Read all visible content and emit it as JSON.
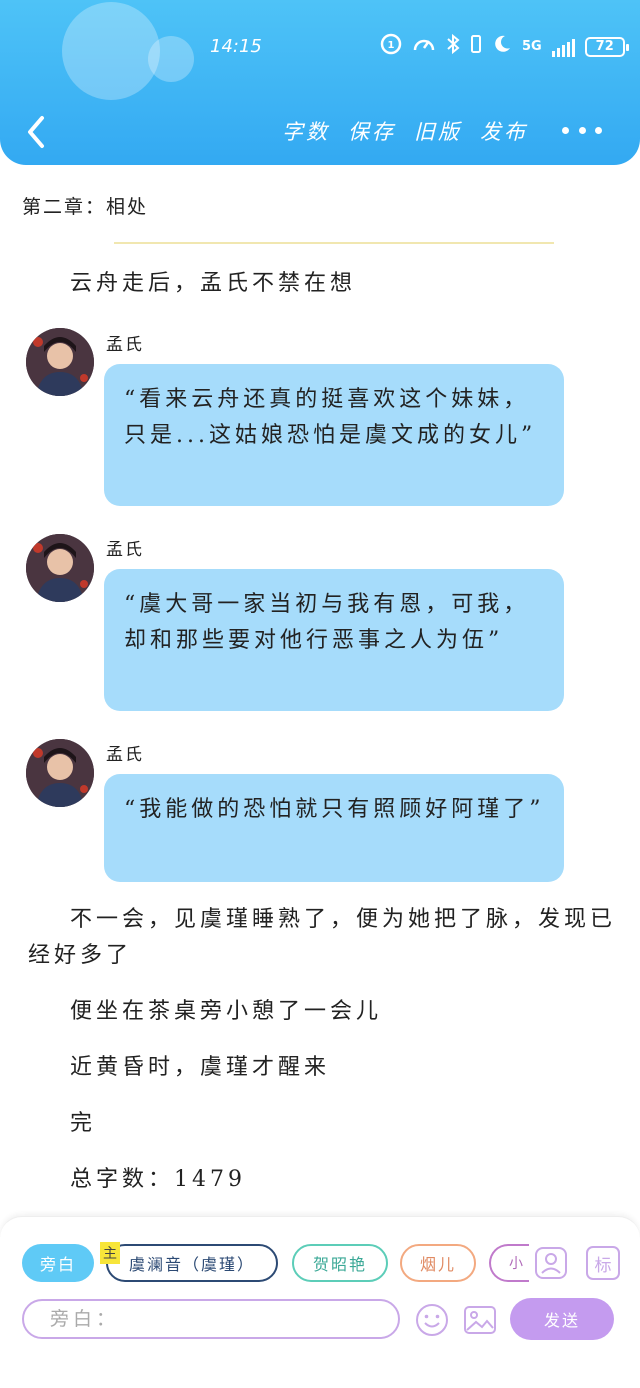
{
  "status_bar": {
    "time": "14:15",
    "network": "5G",
    "battery": "72"
  },
  "toolbar": {
    "word_count_label": "字数",
    "save_label": "保存",
    "old_version_label": "旧版",
    "publish_label": "发布"
  },
  "chapter_title": "第二章：相处",
  "story": {
    "opening": "云舟走后，孟氏不禁在想",
    "messages": [
      {
        "speaker": "孟氏",
        "text": "“看来云舟还真的挺喜欢这个妹妹，只是...这姑娘恐怕是虞文成的女儿”"
      },
      {
        "speaker": "孟氏",
        "text": "“虞大哥一家当初与我有恩，可我，却和那些要对他行恶事之人为伍”"
      },
      {
        "speaker": "孟氏",
        "text": "“我能做的恐怕就只有照顾好阿瑾了”"
      }
    ],
    "para_after_1": "不一会，见虞瑾睡熟了，便为她把了脉，发现已经好多了",
    "para_after_2": "便坐在茶桌旁小憩了一会儿",
    "para_after_3": "近黄昏时，虞瑾才醒来",
    "para_end": "完",
    "total_words": "总字数：1479"
  },
  "role_chips": {
    "narration": "旁白",
    "main_tag": "主",
    "role_1": "虞澜音（虞瑾）",
    "role_2": "贺昭艳",
    "role_3": "烟儿",
    "role_4": "小"
  },
  "icons": {
    "add_role": "add-role-icon",
    "tag": "标",
    "emoji": "emoji-icon",
    "image": "image-icon"
  },
  "input": {
    "placeholder": "旁白："
  },
  "send_label": "发送",
  "colors": {
    "header": "#36aef3",
    "bubble": "#a6dcfb",
    "send": "#c49bef"
  }
}
